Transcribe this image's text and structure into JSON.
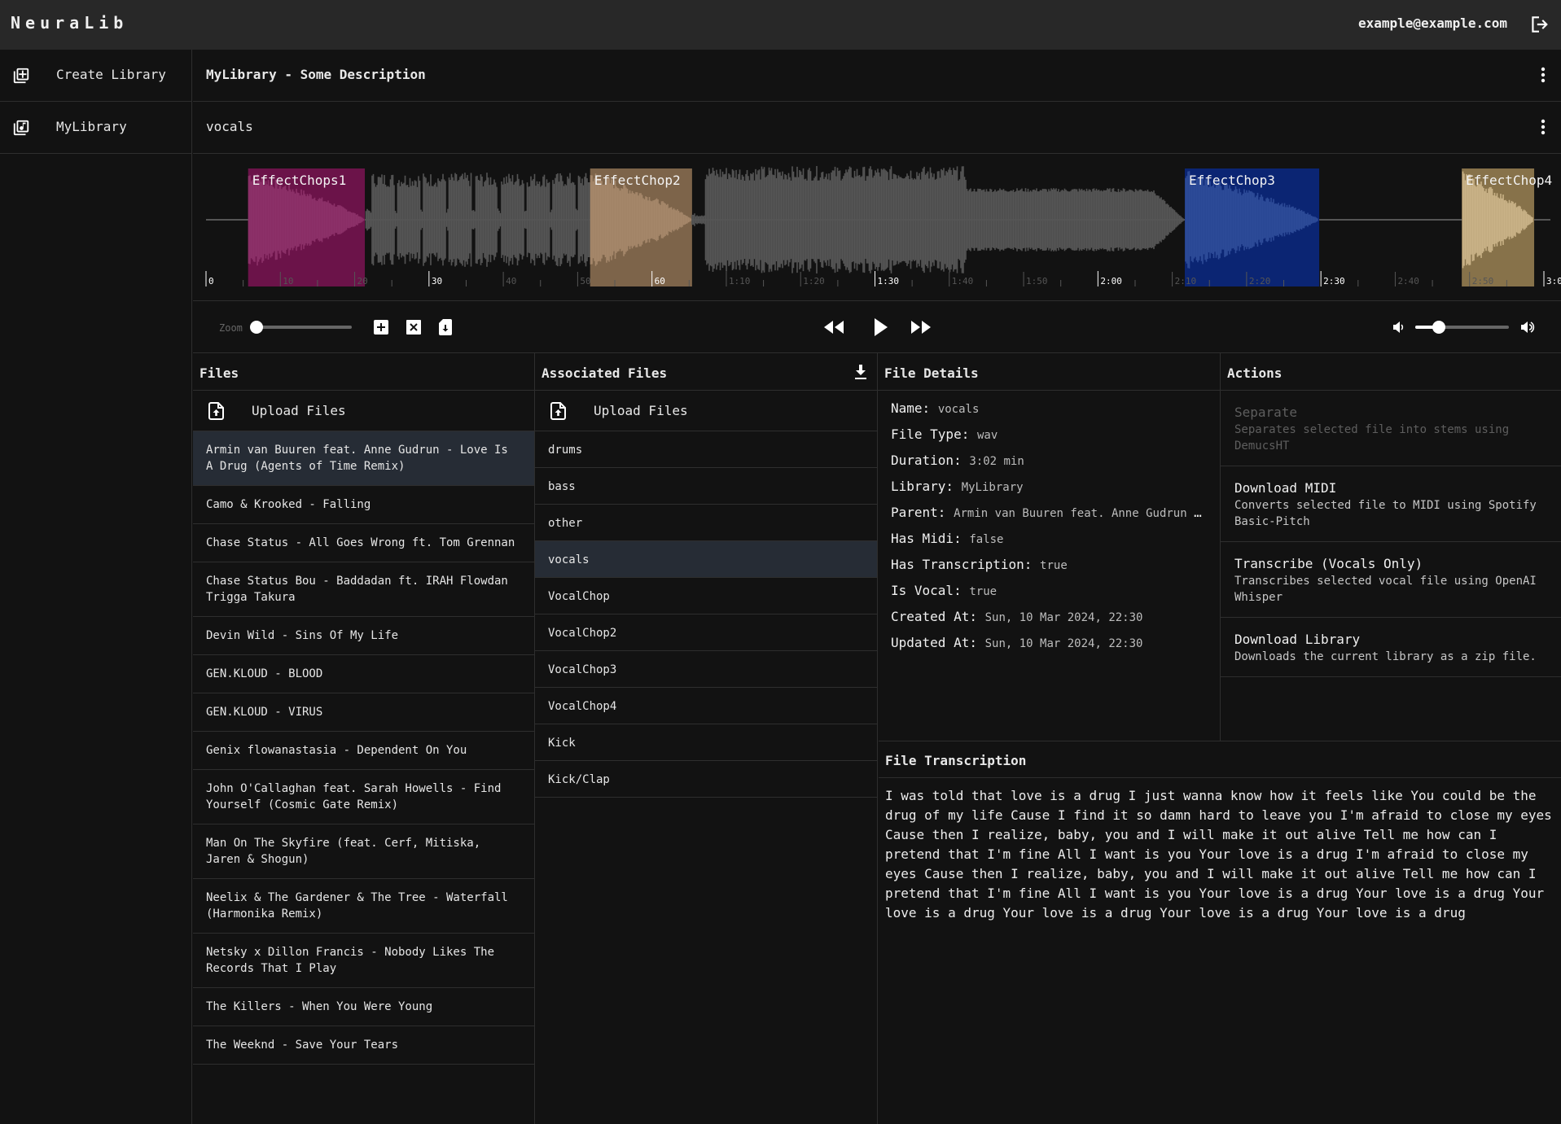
{
  "header": {
    "brand": "NeuraLib",
    "user_email": "example@example.com",
    "logout_icon": "logout-icon"
  },
  "sidebar": {
    "items": [
      {
        "label": "Create Library",
        "icon": "library-add-icon"
      },
      {
        "label": "MyLibrary",
        "icon": "library-music-icon"
      }
    ]
  },
  "library": {
    "title": "MyLibrary - Some Description",
    "menu_icon": "more-vert-icon"
  },
  "file": {
    "name": "vocals",
    "menu_icon": "more-vert-icon"
  },
  "waveform": {
    "duration_seconds": 182,
    "timeline_max_seconds": 180,
    "major_ticks": [
      "0",
      "30",
      "60",
      "1:30",
      "2:00",
      "2:30",
      "3:0"
    ],
    "minor_ticks": [
      "10",
      "20",
      "40",
      "50",
      "1:10",
      "1:20",
      "1:40",
      "1:50",
      "2:10",
      "2:20",
      "2:40",
      "2:50"
    ],
    "regions": [
      {
        "label": "EffectChops1",
        "start": 5.7,
        "end": 21.5,
        "color": "#6b1349",
        "wave_color": "#8c3169"
      },
      {
        "label": "EffectChop2",
        "start": 52.0,
        "end": 65.8,
        "color": "#7d644a",
        "wave_color": "#a5876a"
      },
      {
        "label": "EffectChop3",
        "start": 132.5,
        "end": 150.7,
        "color": "#0b2573",
        "wave_color": "#2d4b98"
      },
      {
        "label": "EffectChop4",
        "start": 170.0,
        "end": 179.8,
        "color": "#87724a",
        "wave_color": "#c9b287"
      }
    ],
    "wave_color": "#555555",
    "progress_color": "#ffffff"
  },
  "controls": {
    "zoom_label": "Zoom",
    "zoom_level": 0.0,
    "add_region_icon": "add-box-icon",
    "clear_regions_icon": "close-box-icon",
    "save_regions_icon": "sd-card-download-icon",
    "rewind_icon": "rewind-icon",
    "play_icon": "play-icon",
    "forward_icon": "fast-forward-icon",
    "volume_low_icon": "volume-down-icon",
    "volume_high_icon": "volume-up-icon",
    "volume_level": 0.25
  },
  "files_panel": {
    "title": "Files",
    "upload_label": "Upload Files",
    "items": [
      "Armin van Buuren feat. Anne Gudrun - Love Is A Drug (Agents of Time Remix)",
      "Camo & Krooked - Falling",
      "Chase Status - All Goes Wrong ft. Tom Grennan",
      "Chase Status Bou - Baddadan ft. IRAH Flowdan Trigga Takura",
      "Devin Wild - Sins Of My Life",
      "GEN.KLOUD - BLOOD",
      "GEN.KLOUD - VIRUS",
      "Genix flowanastasia - Dependent On You",
      "John O'Callaghan feat. Sarah Howells - Find Yourself (Cosmic Gate Remix)",
      "Man On The Skyfire (feat. Cerf, Mitiska, Jaren & Shogun)",
      "Neelix & The Gardener & The Tree - Waterfall (Harmonika Remix)",
      "Netsky x Dillon Francis - Nobody Likes The Records That I Play",
      "The Killers - When You Were Young",
      "The Weeknd - Save Your Tears"
    ],
    "selected_index": 0
  },
  "associated_panel": {
    "title": "Associated Files",
    "download_icon": "download-icon",
    "upload_label": "Upload Files",
    "items": [
      "drums",
      "bass",
      "other",
      "vocals",
      "VocalChop",
      "VocalChop2",
      "VocalChop3",
      "VocalChop4",
      "Kick",
      "Kick/Clap"
    ],
    "selected_index": 3
  },
  "details_panel": {
    "title": "File Details",
    "rows": [
      {
        "key": "Name:",
        "value": "vocals"
      },
      {
        "key": "File Type:",
        "value": "wav"
      },
      {
        "key": "Duration:",
        "value": "3:02 min"
      },
      {
        "key": "Library:",
        "value": "MyLibrary"
      },
      {
        "key": "Parent:",
        "value": "Armin van Buuren feat. Anne Gudrun - Love Is A Drug (Agents of Time Remix)"
      },
      {
        "key": "Has Midi:",
        "value": "false"
      },
      {
        "key": "Has Transcription:",
        "value": "true"
      },
      {
        "key": "Is Vocal:",
        "value": "true"
      },
      {
        "key": "Created At:",
        "value": "Sun, 10 Mar 2024, 22:30"
      },
      {
        "key": "Updated At:",
        "value": "Sun, 10 Mar 2024, 22:30"
      }
    ]
  },
  "actions_panel": {
    "title": "Actions",
    "items": [
      {
        "title": "Separate",
        "description": "Separates selected file into stems using DemucsHT",
        "disabled": true
      },
      {
        "title": "Download MIDI",
        "description": "Converts selected file to MIDI using Spotify Basic-Pitch",
        "disabled": false
      },
      {
        "title": "Transcribe (Vocals Only)",
        "description": "Transcribes selected vocal file using OpenAI Whisper",
        "disabled": false
      },
      {
        "title": "Download Library",
        "description": "Downloads the current library as a zip file.",
        "disabled": false
      }
    ]
  },
  "transcription_panel": {
    "title": "File Transcription",
    "text": "I was told that love is a drug I just wanna know how it feels like You could be the drug of my life Cause I find it so damn hard to leave you I'm afraid to close my eyes Cause then I realize, baby, you and I will make it out alive Tell me how can I pretend that I'm fine All I want is you Your love is a drug I'm afraid to close my eyes Cause then I realize, baby, you and I will make it out alive Tell me how can I pretend that I'm fine All I want is you Your love is a drug Your love is a drug Your love is a drug Your love is a drug Your love is a drug Your love is a drug"
  }
}
